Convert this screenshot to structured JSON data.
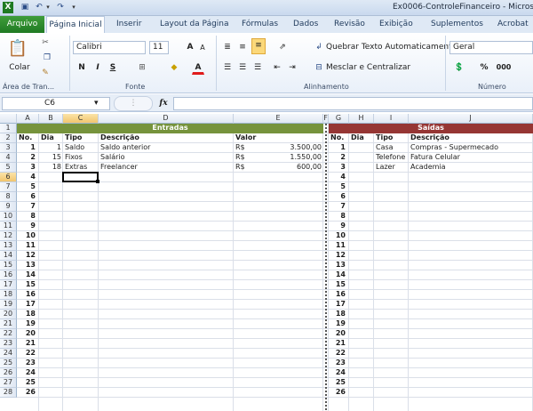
{
  "window": {
    "title": "Ex0006-ControleFinanceiro - Microso"
  },
  "tabs": {
    "file": "Arquivo",
    "items": [
      "Página Inicial",
      "Inserir",
      "Layout da Página",
      "Fórmulas",
      "Dados",
      "Revisão",
      "Exibição",
      "Suplementos",
      "Acrobat"
    ]
  },
  "ribbon": {
    "clipboard": {
      "paste": "Colar",
      "label": "Área de Tran..."
    },
    "font": {
      "name": "Calibri",
      "size": "11",
      "bold": "N",
      "italic": "I",
      "underline": "S",
      "grow": "A",
      "shrink": "A",
      "color": "A",
      "label": "Fonte"
    },
    "alignment": {
      "wrap": "Quebrar Texto Automaticamente",
      "merge": "Mesclar e Centralizar",
      "label": "Alinhamento"
    },
    "number": {
      "format": "Geral",
      "percent": "%",
      "comma": "000",
      "label": "Número"
    }
  },
  "formula_bar": {
    "name_box": "C6",
    "fx": "fx",
    "content": ""
  },
  "sheet": {
    "columns": [
      "A",
      "B",
      "C",
      "D",
      "E",
      "F",
      "G",
      "H",
      "I",
      "J"
    ],
    "selected_column": "C",
    "selected_row": 6,
    "rows": [
      "1",
      "2",
      "3",
      "4",
      "5",
      "6",
      "7",
      "8",
      "9",
      "10",
      "11",
      "12",
      "13",
      "14",
      "15",
      "16",
      "17",
      "18",
      "19",
      "20",
      "21",
      "22",
      "23",
      "24",
      "25",
      "26",
      "27",
      "28"
    ],
    "entradas": {
      "title": "Entradas",
      "headers": {
        "no": "No.",
        "dia": "Dia",
        "tipo": "Tipo",
        "descricao": "Descrição",
        "valor": "Valor"
      },
      "numbers": [
        "1",
        "2",
        "3",
        "4",
        "5",
        "6",
        "7",
        "8",
        "9",
        "10",
        "11",
        "12",
        "13",
        "14",
        "15",
        "16",
        "17",
        "18",
        "19",
        "20",
        "21",
        "22",
        "23",
        "24",
        "25",
        "26",
        "27"
      ],
      "entries": [
        {
          "dia": "1",
          "tipo": "Saldo",
          "descricao": "Saldo anterior",
          "moeda": "R$",
          "valor": "3.500,00"
        },
        {
          "dia": "15",
          "tipo": "Fixos",
          "descricao": "Salário",
          "moeda": "R$",
          "valor": "1.550,00"
        },
        {
          "dia": "18",
          "tipo": "Extras",
          "descricao": "Freelancer",
          "moeda": "R$",
          "valor": "600,00"
        }
      ]
    },
    "saidas": {
      "title": "Saídas",
      "headers": {
        "no": "No.",
        "dia": "Dia",
        "tipo": "Tipo",
        "descricao": "Descrição"
      },
      "numbers": [
        "1",
        "2",
        "3",
        "4",
        "5",
        "6",
        "7",
        "8",
        "9",
        "10",
        "11",
        "12",
        "13",
        "14",
        "15",
        "16",
        "17",
        "18",
        "19",
        "20",
        "21",
        "22",
        "23",
        "24",
        "25",
        "26",
        "27"
      ],
      "entries": [
        {
          "tipo": "Casa",
          "descricao": "Compras - Supermecado"
        },
        {
          "tipo": "Telefone",
          "descricao": "Fatura Celular"
        },
        {
          "tipo": "Lazer",
          "descricao": "Academia"
        }
      ]
    },
    "colors": {
      "entradas_header": "#76933c",
      "saidas_header": "#963634",
      "selection": "#f2c56e"
    }
  }
}
